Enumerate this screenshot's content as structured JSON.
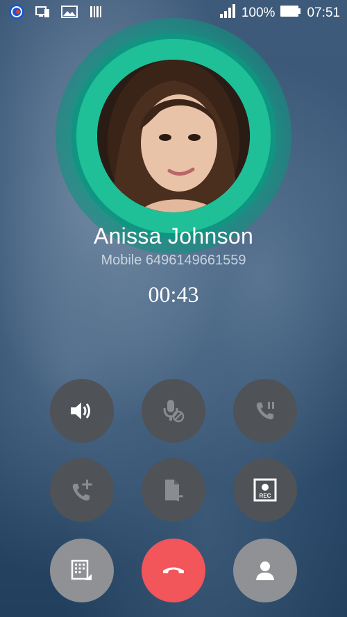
{
  "status_bar": {
    "icons_left": [
      "call-recorder-icon",
      "device-icon",
      "image-icon",
      "barcode-icon"
    ],
    "signal_icon": "signal-icon",
    "battery_percent": "100%",
    "battery_icon": "battery-icon",
    "time": "07:51"
  },
  "contact": {
    "name": "Anissa Johnson",
    "subtitle": "Mobile 6496149661559"
  },
  "call": {
    "duration": "00:43"
  },
  "buttons": [
    {
      "name": "speaker-button",
      "icon": "speaker-icon"
    },
    {
      "name": "mute-button",
      "icon": "mic-off-icon"
    },
    {
      "name": "hold-button",
      "icon": "call-hold-icon"
    },
    {
      "name": "add-call-button",
      "icon": "add-call-icon"
    },
    {
      "name": "add-note-button",
      "icon": "note-add-icon"
    },
    {
      "name": "record-button",
      "icon": "rec-icon",
      "label": "REC"
    },
    {
      "name": "dialpad-button",
      "icon": "dialpad-icon"
    },
    {
      "name": "end-call-button",
      "icon": "hangup-icon"
    },
    {
      "name": "contact-button",
      "icon": "person-icon"
    }
  ],
  "colors": {
    "ring": "#1fbf97",
    "button": "#4f5257",
    "button_light": "#8f9195",
    "end_call": "#f2555a"
  }
}
